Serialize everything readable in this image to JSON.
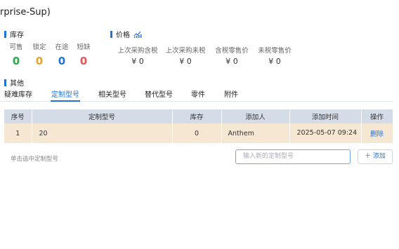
{
  "window_title": "rprise-Sup)",
  "stock_section": {
    "title": "库存",
    "items": [
      {
        "label": "可售",
        "value": "0",
        "color": "#2aa84a"
      },
      {
        "label": "锁定",
        "value": "0",
        "color": "#e0a52a"
      },
      {
        "label": "在途",
        "value": "0",
        "color": "#1f74d6"
      },
      {
        "label": "短缺",
        "value": "0",
        "color": "#e05555"
      }
    ]
  },
  "price_section": {
    "title": "价格",
    "icon": "chart-icon",
    "items": [
      {
        "label": "上次采购含税",
        "value": "¥ 0"
      },
      {
        "label": "上次采购未税",
        "value": "¥ 0"
      },
      {
        "label": "含税零售价",
        "value": "¥ 0"
      },
      {
        "label": "未税零售价",
        "value": "¥ 0"
      }
    ]
  },
  "other_section": {
    "title": "其他"
  },
  "tabs": [
    "疑难库存",
    "定制型号",
    "相关型号",
    "替代型号",
    "零件",
    "附件"
  ],
  "active_tab": "定制型号",
  "table": {
    "headers": [
      "序号",
      "定制型号",
      "库存",
      "添加人",
      "添加时间",
      "操作"
    ],
    "rows": [
      {
        "index": "1",
        "model": "20",
        "stock": "0",
        "user": "Anthem",
        "time": "2025-05-07 09:24",
        "action": "删除"
      }
    ]
  },
  "hint": "单击选中定制型号",
  "input_placeholder": "输入新的定制型号",
  "add_button": "＋ 添加"
}
